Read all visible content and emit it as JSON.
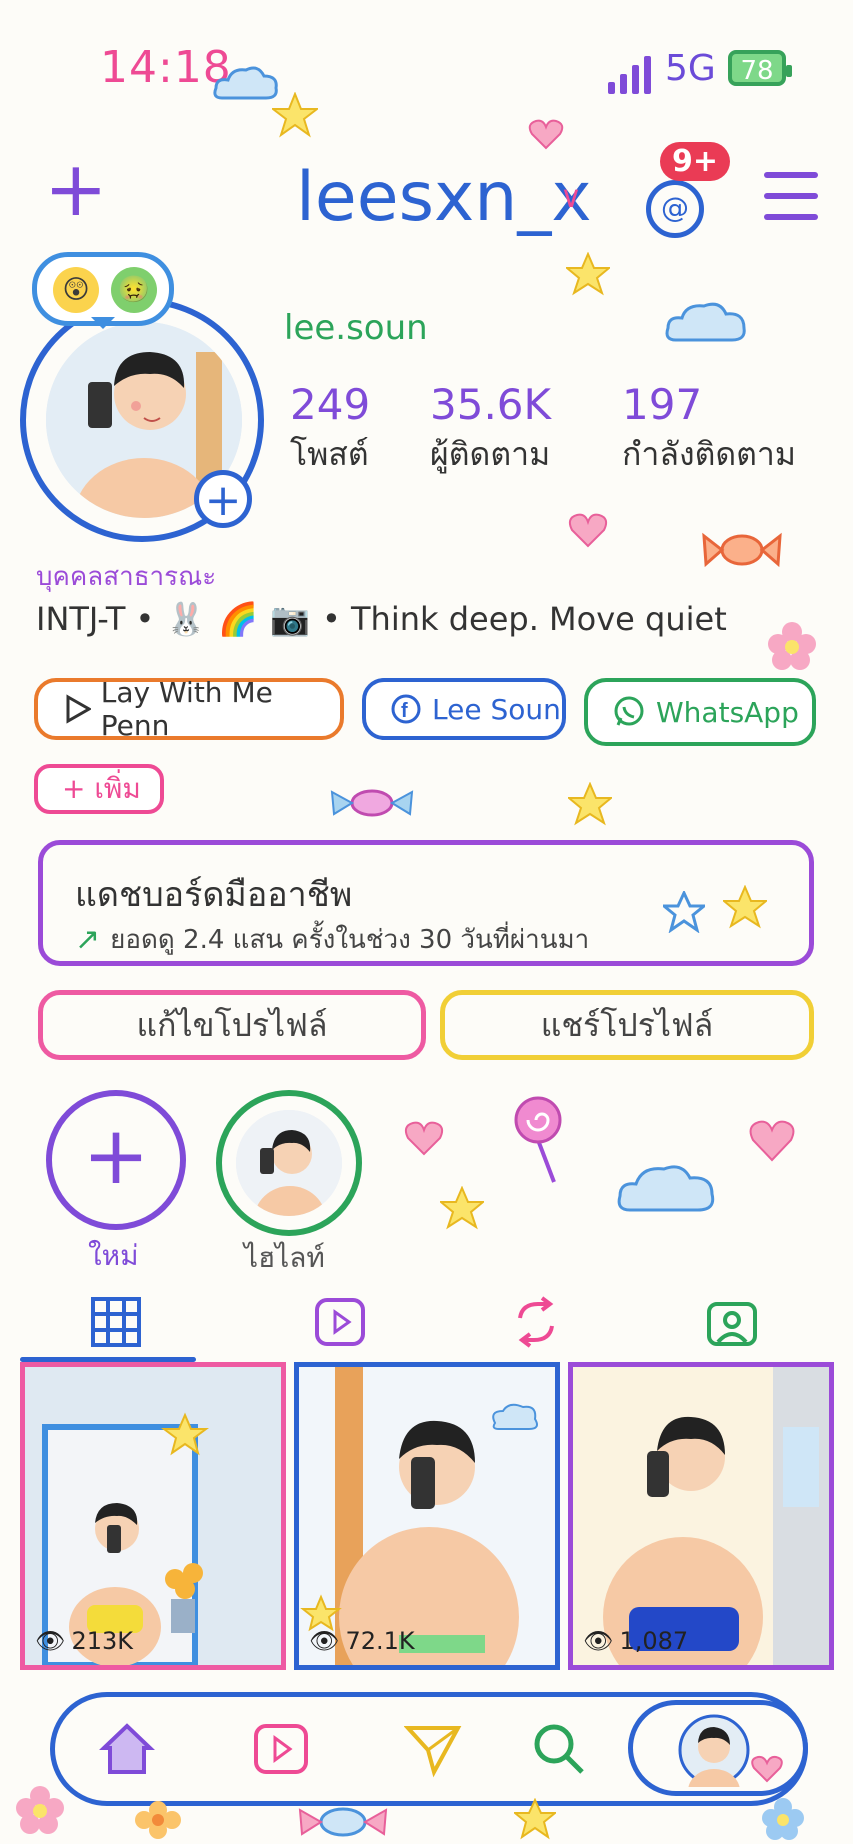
{
  "status_bar": {
    "time": "14:18",
    "network": "5G",
    "battery": "78"
  },
  "header": {
    "username": "leesxn_x",
    "notification_badge": "9+"
  },
  "profile": {
    "display_name": "lee.soun",
    "stats": [
      {
        "value": "249",
        "label": "โพสต์"
      },
      {
        "value": "35.6K",
        "label": "ผู้ติดตาม"
      },
      {
        "value": "197",
        "label": "กำลังติดตาม"
      }
    ],
    "category": "บุคคลสาธารณะ",
    "bio_prefix": "INTJ-T •",
    "bio_suffix": "• Think deep. Move quiet"
  },
  "links": [
    {
      "label": "Lay With Me Penn",
      "icon": "play-icon",
      "color": "#ea7a2c"
    },
    {
      "label": "Lee Soun",
      "icon": "facebook-icon",
      "color": "#2d63d1"
    },
    {
      "label": "WhatsApp",
      "icon": "whatsapp-icon",
      "color": "#2ca45a"
    }
  ],
  "add_link_label": "+ เพิ่ม",
  "dashboard": {
    "title": "แดชบอร์ดมืออาชีพ",
    "subtitle": "ยอดดู 2.4 แสน ครั้งในช่วง 30 วันที่ผ่านมา"
  },
  "buttons": {
    "edit": "แก้ไขโปรไฟล์",
    "share": "แชร์โปรไฟล์"
  },
  "highlights": [
    {
      "label": "ใหม่"
    },
    {
      "label": "ไฮไลท์"
    }
  ],
  "posts": [
    {
      "views": "213K",
      "border": "#ee5aa2"
    },
    {
      "views": "72.1K",
      "border": "#2d63d1"
    },
    {
      "views": "1,087",
      "border": "#9b4bd8"
    }
  ]
}
